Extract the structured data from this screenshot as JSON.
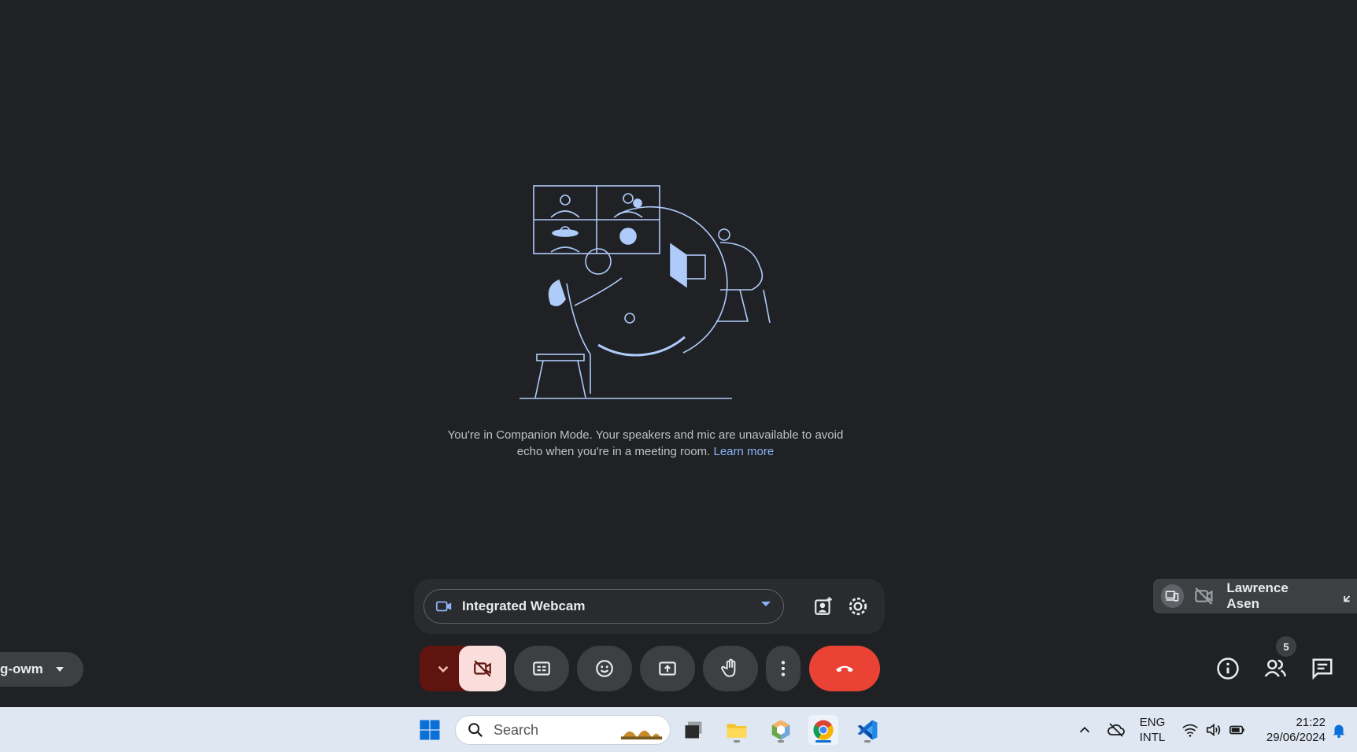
{
  "companion": {
    "message": "You're in Companion Mode. Your speakers and mic are unavailable to avoid echo when you're in a meeting room.",
    "learn_more": "Learn more"
  },
  "device_bar": {
    "camera_label": "Integrated Webcam"
  },
  "meeting_code_chip": "g-owm",
  "self_tile": {
    "name": "Lawrence Asen"
  },
  "people_count": "5",
  "taskbar": {
    "search_placeholder": "Search",
    "lang_top": "ENG",
    "lang_bottom": "INTL",
    "time": "21:22",
    "date": "29/06/2024"
  },
  "colors": {
    "background": "#202124",
    "accent": "#8ab4f8",
    "end_call": "#ea4335",
    "camera_off": "#f9dedc",
    "taskbar": "#dfe7f2"
  }
}
